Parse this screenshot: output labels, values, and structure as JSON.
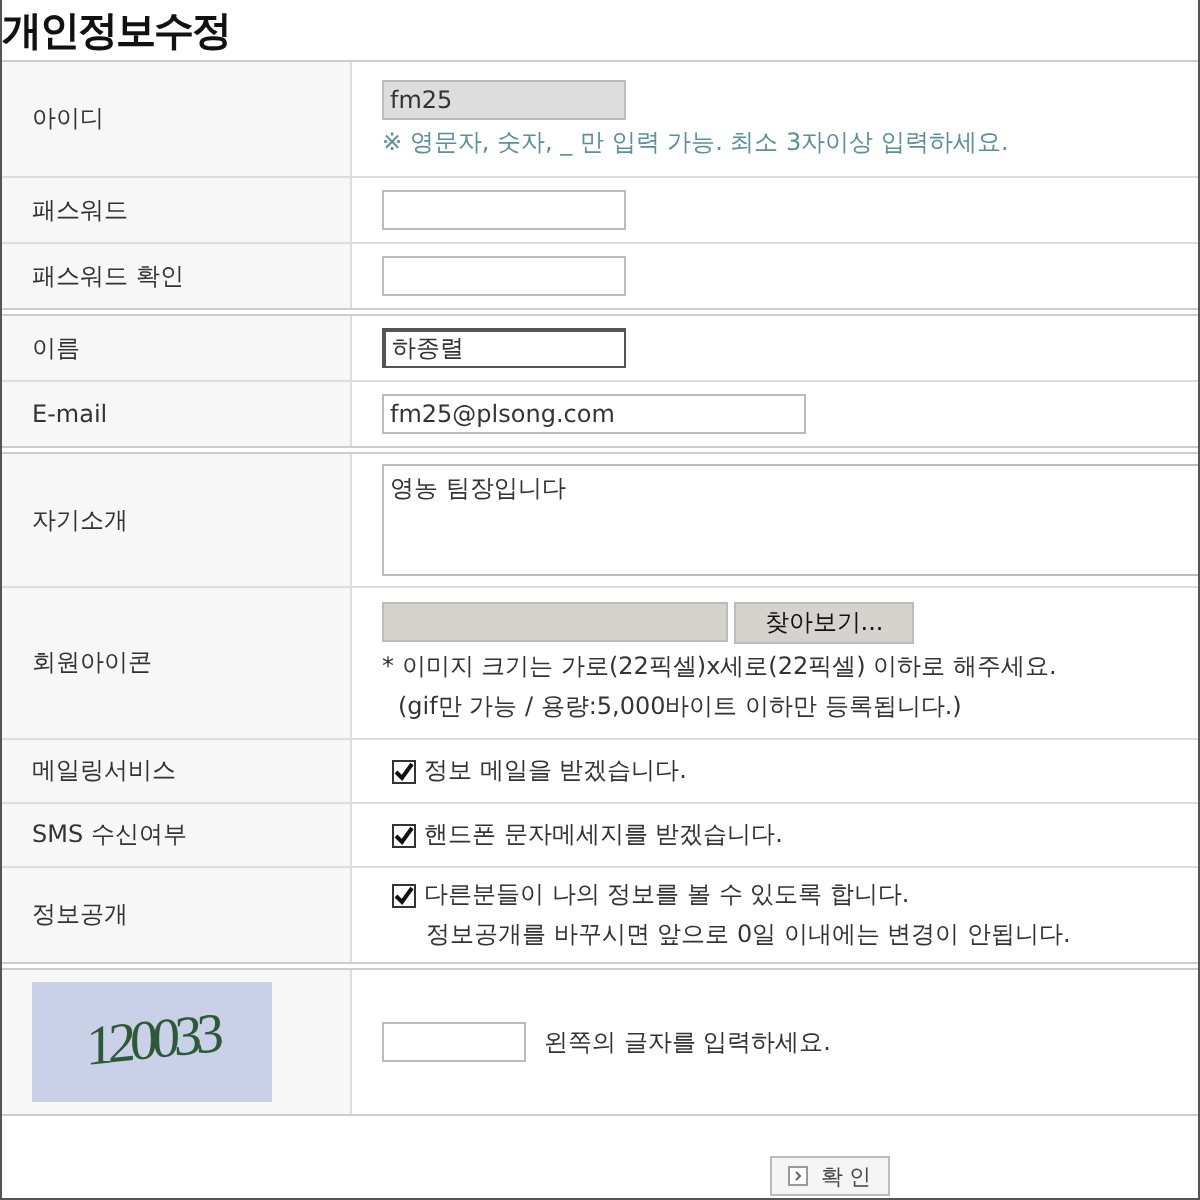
{
  "title": "개인정보수정",
  "sections": [
    {
      "rows": [
        {
          "label": "아이디",
          "kind": "text",
          "value": "fm25",
          "disabled": true,
          "hint": "※ 영문자, 숫자, _ 만 입력 가능. 최소 3자이상 입력하세요."
        },
        {
          "label": "패스워드",
          "kind": "password",
          "value": ""
        },
        {
          "label": "패스워드 확인",
          "kind": "password",
          "value": ""
        }
      ]
    },
    {
      "rows": [
        {
          "label": "이름",
          "kind": "text",
          "value": "하종렬",
          "disabled": false,
          "focused": true
        },
        {
          "label": "E-mail",
          "kind": "email",
          "value": "fm25@plsong.com"
        }
      ]
    },
    {
      "rows": [
        {
          "label": "자기소개",
          "kind": "textarea",
          "value": "영농 팀장입니다"
        },
        {
          "label": "회원아이콘",
          "kind": "file",
          "button": "찾아보기...",
          "notes": [
            "* 이미지 크기는 가로(22픽셀)x세로(22픽셀) 이하로 해주세요.",
            "(gif만 가능 / 용량:5,000바이트 이하만 등록됩니다.)"
          ]
        },
        {
          "label": "메일링서비스",
          "kind": "checkbox",
          "checked": true,
          "text": "정보 메일을 받겠습니다."
        },
        {
          "label": "SMS 수신여부",
          "kind": "checkbox",
          "checked": true,
          "text": "핸드폰 문자메세지를 받겠습니다."
        },
        {
          "label": "정보공개",
          "kind": "checkbox",
          "checked": true,
          "text": "다른분들이 나의 정보를 볼 수 있도록 합니다.",
          "note": "정보공개를 바꾸시면 앞으로 0일 이내에는 변경이 안됩니다."
        }
      ]
    },
    {
      "rows": [
        {
          "kind": "captcha",
          "code": "120033",
          "value": "",
          "text": "왼쪽의 글자를 입력하세요."
        }
      ]
    }
  ],
  "submit": "확 인"
}
